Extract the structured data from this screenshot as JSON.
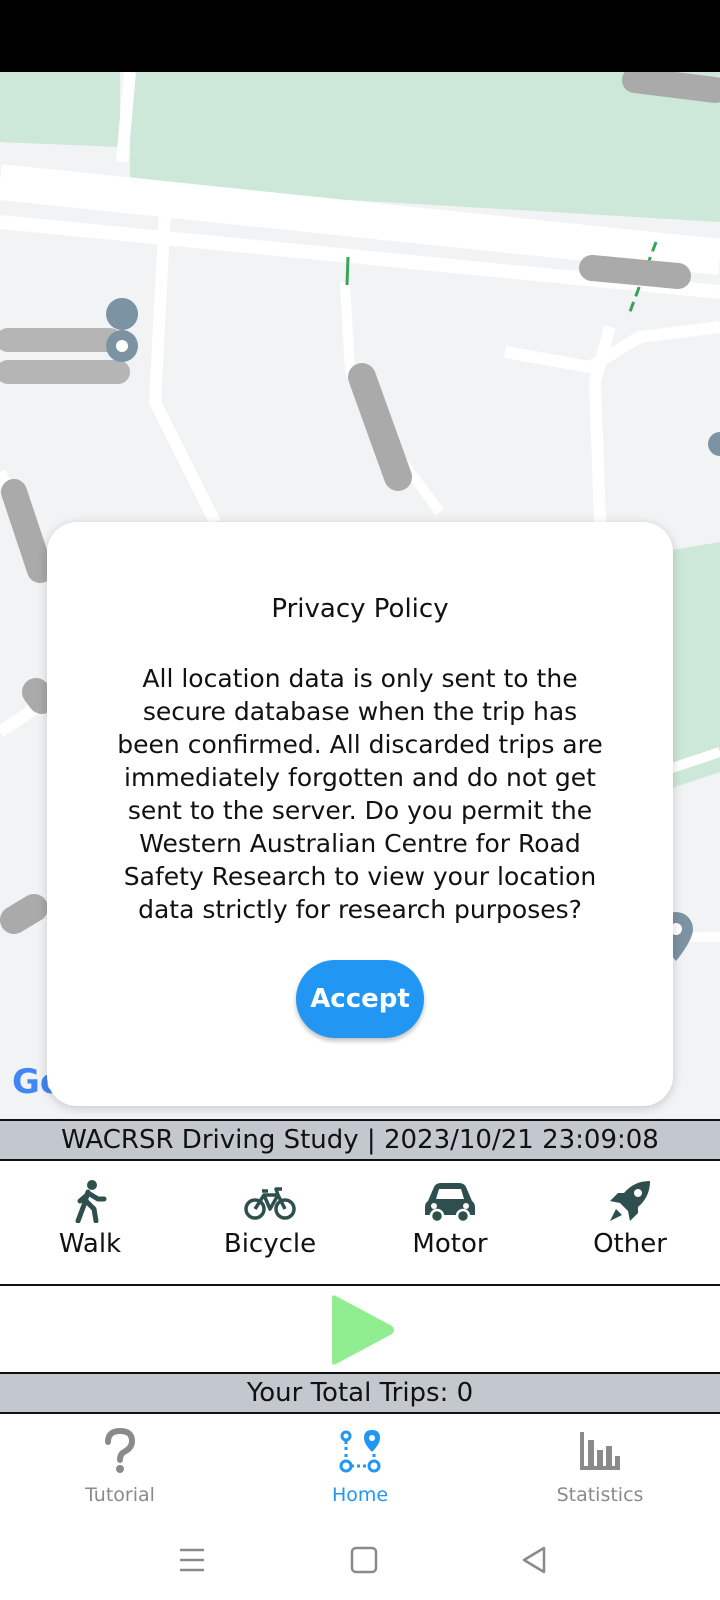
{
  "dialog": {
    "title": "Privacy Policy",
    "body": "All location data is only sent to the secure database when the trip has been confirmed. All discarded trips are immediately forgotten and do not get sent to the server. Do you permit the Western Australian Centre for Road Safety Research to view your location data strictly for research purposes?",
    "accept_label": "Accept"
  },
  "map": {
    "logo_text": "Go"
  },
  "header": {
    "title": "WACRSR Driving Study | 2023/10/21 23:09:08"
  },
  "modes": [
    {
      "label": "Walk",
      "icon": "walk-icon"
    },
    {
      "label": "Bicycle",
      "icon": "bicycle-icon"
    },
    {
      "label": "Motor",
      "icon": "car-icon"
    },
    {
      "label": "Other",
      "icon": "rocket-icon"
    }
  ],
  "play": {
    "icon": "play-icon",
    "color": "#90ee90"
  },
  "trips": {
    "label": "Your Total Trips: 0"
  },
  "tabs": [
    {
      "label": "Tutorial",
      "icon": "question-icon",
      "active": false
    },
    {
      "label": "Home",
      "icon": "route-icon",
      "active": true
    },
    {
      "label": "Statistics",
      "icon": "bar-chart-icon",
      "active": false
    }
  ],
  "colors": {
    "accent": "#2196f3",
    "bar_background": "#c3c7ce",
    "icon_dark": "#2f4f4f",
    "play_green": "#90ee90",
    "inactive_tab": "#8a8a8a"
  }
}
